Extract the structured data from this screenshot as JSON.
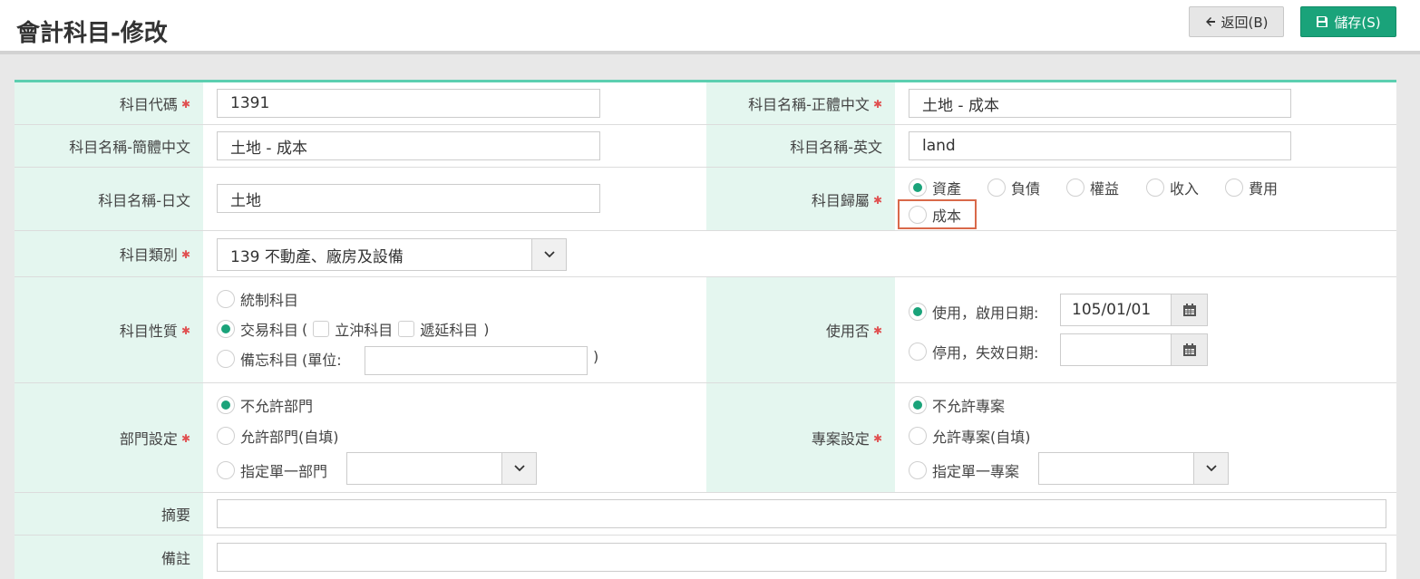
{
  "header": {
    "title": "會計科目-修改",
    "back_label": "返回(B)",
    "save_label": "儲存(S)"
  },
  "form": {
    "code": {
      "label": "科目代碼",
      "value": "1391"
    },
    "name_tc": {
      "label": "科目名稱-正體中文",
      "value": "土地 - 成本"
    },
    "name_sc": {
      "label": "科目名稱-簡體中文",
      "value": "土地 - 成本"
    },
    "name_en": {
      "label": "科目名稱-英文",
      "value": "land"
    },
    "name_jp": {
      "label": "科目名稱-日文",
      "value": "土地"
    },
    "belong": {
      "label": "科目歸屬",
      "options": [
        "資產",
        "負債",
        "權益",
        "收入",
        "費用",
        "成本"
      ],
      "selected": "資產"
    },
    "category": {
      "label": "科目類別",
      "value": "139 不動產、廠房及設備"
    },
    "nature": {
      "label": "科目性質",
      "opt_control": "統制科目",
      "opt_trade": "交易科目",
      "paren_open": "(",
      "paren_close": ")",
      "cb_offset": "立沖科目",
      "cb_defer": "遞延科目",
      "opt_memo": "備忘科目",
      "unit_label": "(單位:",
      "unit_value": "",
      "selected": "交易科目"
    },
    "usage": {
      "label": "使用否",
      "opt_use": "使用，啟用日期:",
      "use_date": "105/01/01",
      "opt_stop": "停用，失效日期:",
      "stop_date": "",
      "selected": "使用"
    },
    "dept": {
      "label": "部門設定",
      "opt1": "不允許部門",
      "opt2": "允許部門(自填)",
      "opt3": "指定單一部門",
      "select_value": "",
      "selected": "不允許部門"
    },
    "project": {
      "label": "專案設定",
      "opt1": "不允許專案",
      "opt2": "允許專案(自填)",
      "opt3": "指定單一專案",
      "select_value": "",
      "selected": "不允許專案"
    },
    "summary": {
      "label": "摘要",
      "value": ""
    },
    "remark": {
      "label": "備註",
      "value": ""
    }
  },
  "colors": {
    "accent": "#1aa37a",
    "label_bg": "#e4f6ef",
    "top_border": "#5ccfb0",
    "highlight": "#d9694a"
  }
}
